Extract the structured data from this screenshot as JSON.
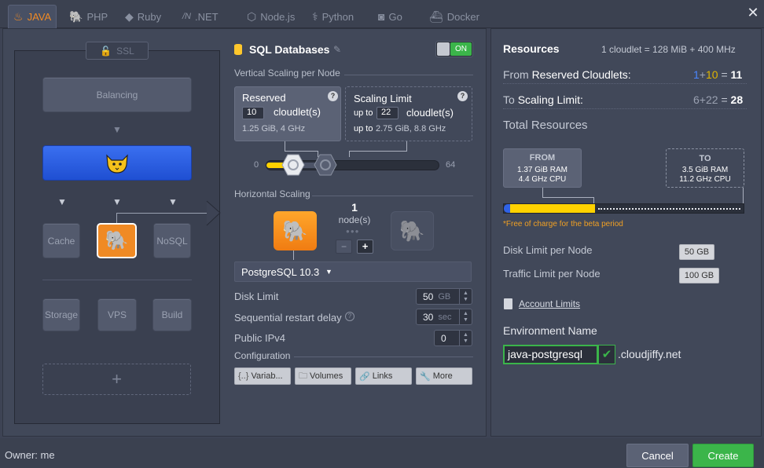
{
  "tabs": [
    {
      "label": "JAVA",
      "icon": "java-icon"
    },
    {
      "label": "PHP",
      "icon": "php-icon"
    },
    {
      "label": "Ruby",
      "icon": "ruby-icon"
    },
    {
      "label": ".NET",
      "icon": "dotnet-icon"
    },
    {
      "label": "Node.js",
      "icon": "nodejs-icon"
    },
    {
      "label": "Python",
      "icon": "python-icon"
    },
    {
      "label": "Go",
      "icon": "go-icon"
    },
    {
      "label": "Docker",
      "icon": "docker-icon"
    }
  ],
  "topology": {
    "ssl": "SSL",
    "balancing": "Balancing",
    "cache": "Cache",
    "nosql": "NoSQL",
    "storage": "Storage",
    "vps": "VPS",
    "build": "Build",
    "add": "+"
  },
  "middle": {
    "title": "SQL Databases",
    "toggle": "ON",
    "vertical_title": "Vertical Scaling per Node",
    "reserved": {
      "label": "Reserved",
      "value": "10",
      "unit": "cloudlet(s)",
      "info": "1.25 GiB, 4 GHz"
    },
    "limit": {
      "label": "Scaling Limit",
      "prefix": "up to",
      "value": "22",
      "unit": "cloudlet(s)",
      "info_prefix": "up to",
      "info": "2.75 GiB, 8.8 GHz"
    },
    "slider": {
      "min": "0",
      "max": "64",
      "reserved": 10,
      "limit": 22,
      "total": 64
    },
    "horizontal_title": "Horizontal Scaling",
    "nodes_count": "1",
    "nodes_label": "node(s)",
    "minus": "−",
    "plus": "+",
    "stack": "PostgreSQL 10.3",
    "disk_limit": {
      "label": "Disk Limit",
      "value": "50",
      "unit": "GB"
    },
    "restart_delay": {
      "label": "Sequential restart delay",
      "value": "30",
      "unit": "sec"
    },
    "ipv4": {
      "label": "Public IPv4",
      "value": "0"
    },
    "configuration_title": "Configuration",
    "config_buttons": [
      "Variab...",
      "Volumes",
      "Links",
      "More"
    ]
  },
  "resources": {
    "title": "Resources",
    "cloudlet_def": "1 cloudlet = 128 MiB + 400 MHz",
    "from_prefix": "From",
    "from_label": "Reserved Cloudlets:",
    "from_a": "1",
    "from_plus": "+",
    "from_b": "10",
    "from_eq": "=",
    "from_total": "11",
    "to_prefix": "To",
    "to_label": "Scaling Limit:",
    "to_a": "6",
    "to_plus": "+",
    "to_b": "22",
    "to_eq": "=",
    "to_total": "28",
    "total_title": "Total Resources",
    "from_box": {
      "title": "FROM",
      "ram": "1.37 GiB RAM",
      "cpu": "4.4 GHz CPU"
    },
    "to_box": {
      "title": "TO",
      "ram": "3.5 GiB RAM",
      "cpu": "11.2 GHz CPU"
    },
    "free_note": "*Free of charge for the beta period",
    "disk_limit_label": "Disk Limit per Node",
    "disk_limit_value": "50 GB",
    "traffic_label": "Traffic Limit per Node",
    "traffic_value": "100 GB",
    "account_limits": "Account Limits",
    "env_name_label": "Environment Name",
    "env_name_value": "java-postgresql",
    "domain": ".cloudjiffy.net",
    "bar": {
      "blue_fraction": 0.015,
      "yellow_fraction": 0.38
    }
  },
  "footer": {
    "owner": "Owner: me",
    "cancel": "Cancel",
    "create": "Create"
  },
  "colors": {
    "accent": "#f08a24",
    "green": "#3bb54a",
    "blue": "#2f62e6",
    "yellow": "#ffd200"
  }
}
